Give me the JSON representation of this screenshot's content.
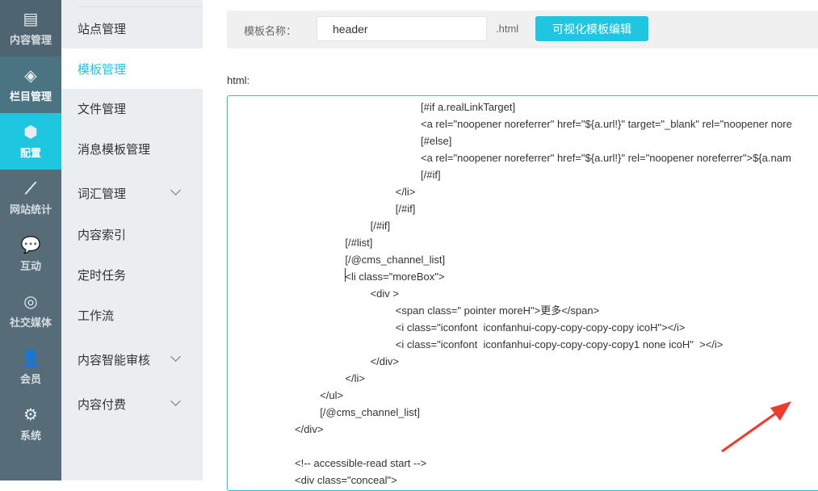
{
  "nav": [
    {
      "label": "内容管理",
      "icon": "document-edit-icon",
      "glyph": "▤"
    },
    {
      "label": "栏目管理",
      "icon": "layers-icon",
      "glyph": "◈"
    },
    {
      "label": "配置",
      "icon": "cube-icon",
      "glyph": "⬢"
    },
    {
      "label": "网站统计",
      "icon": "line-chart-icon",
      "glyph": "⟋"
    },
    {
      "label": "互动",
      "icon": "chat-icon",
      "glyph": "💬"
    },
    {
      "label": "社交媒体",
      "icon": "social-icon",
      "glyph": "◎"
    },
    {
      "label": "会员",
      "icon": "member-icon",
      "glyph": "👤"
    },
    {
      "label": "系统",
      "icon": "gear-icon",
      "glyph": "⚙"
    }
  ],
  "submenu": [
    {
      "label": "站点管理"
    },
    {
      "label": "模板管理",
      "active": true
    },
    {
      "label": "文件管理"
    },
    {
      "label": "消息模板管理"
    },
    {
      "label": "词汇管理",
      "expandable": true
    },
    {
      "label": "内容索引"
    },
    {
      "label": "定时任务"
    },
    {
      "label": "工作流"
    },
    {
      "label": "内容智能审核",
      "expandable": true
    },
    {
      "label": "内容付费",
      "expandable": true
    }
  ],
  "form": {
    "name_label": "模板名称：",
    "name_value": "header",
    "ext": ".html",
    "visual_edit_button": "可视化模板编辑",
    "html_label": "html:"
  },
  "colors": {
    "accent": "#1fc6e0",
    "nav_bg": "#566d79",
    "arrow": "#f03a2e"
  },
  "code_lines": [
    {
      "indent": 5,
      "text": "[#if a.realLinkTarget]"
    },
    {
      "indent": 5,
      "text": "<a rel=\"noopener noreferrer\" href=\"${a.url!}\" target=\"_blank\" rel=\"noopener nore"
    },
    {
      "indent": 5,
      "text": "[#else]"
    },
    {
      "indent": 5,
      "text": "<a rel=\"noopener noreferrer\" href=\"${a.url!}\" rel=\"noopener noreferrer\">${a.nam"
    },
    {
      "indent": 5,
      "text": "[/#if]"
    },
    {
      "indent": 4,
      "text": "</li>"
    },
    {
      "indent": 4,
      "text": "[/#if]"
    },
    {
      "indent": 3,
      "text": "[/#if]"
    },
    {
      "indent": 2,
      "text": "[/#list]"
    },
    {
      "indent": 2,
      "text": "[/@cms_channel_list]"
    },
    {
      "indent": 2,
      "text": "<li class=\"moreBox\">"
    },
    {
      "indent": 3,
      "text": "<div >"
    },
    {
      "indent": 4,
      "text": "<span class=\" pointer moreH\">更多</span>"
    },
    {
      "indent": 4,
      "text": "<i class=\"iconfont  iconfanhui-copy-copy-copy-copy icoH\"></i>"
    },
    {
      "indent": 4,
      "text": "<i class=\"iconfont  iconfanhui-copy-copy-copy-copy1 none icoH\"  ></i>"
    },
    {
      "indent": 3,
      "text": "</div>"
    },
    {
      "indent": 2,
      "text": "</li>"
    },
    {
      "indent": 1,
      "text": "</ul>"
    },
    {
      "indent": 1,
      "text": "[/@cms_channel_list]"
    },
    {
      "indent": 0,
      "text": "</div>"
    },
    {
      "indent": 0,
      "text": ""
    },
    {
      "indent": 0,
      "text": "<!-- accessible-read start -->"
    },
    {
      "indent": 0,
      "text": "<div class=\"conceal\">"
    }
  ]
}
